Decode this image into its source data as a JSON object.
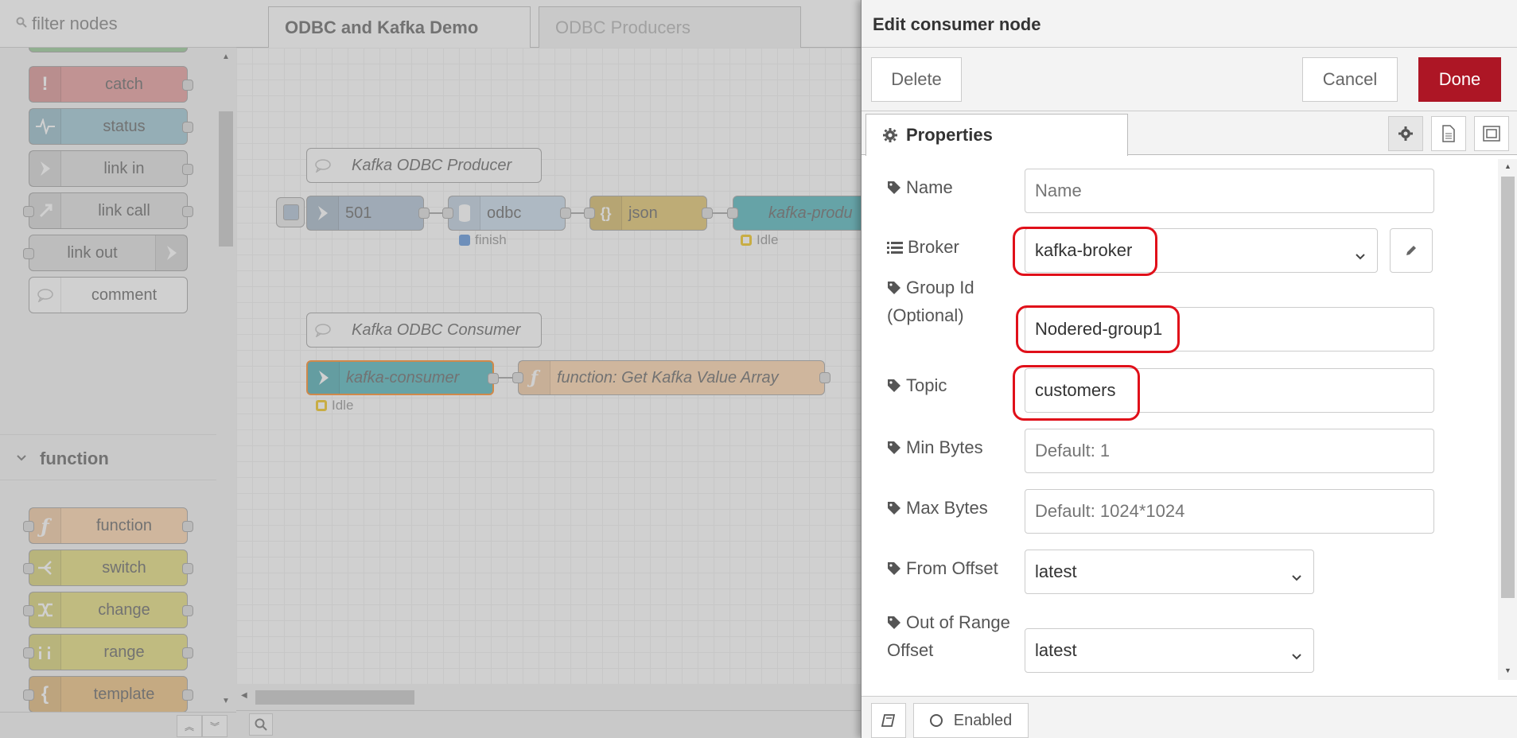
{
  "palette": {
    "search_placeholder": "filter nodes",
    "nodes_top": [
      {
        "label": "catch",
        "color": "#e49191"
      },
      {
        "label": "status",
        "color": "#94c1d0"
      },
      {
        "label": "link in",
        "color": "#dddddd"
      },
      {
        "label": "link call",
        "color": "#dddddd"
      },
      {
        "label": "link out",
        "color": "#dddddd"
      },
      {
        "label": "comment",
        "color": "#ffffff"
      }
    ],
    "category": "function",
    "nodes_function": [
      {
        "label": "function",
        "color": "#fdd0a2"
      },
      {
        "label": "switch",
        "color": "#e2d96e"
      },
      {
        "label": "change",
        "color": "#e2d96e"
      },
      {
        "label": "range",
        "color": "#e2d96e"
      },
      {
        "label": "template",
        "color": "#ebba71"
      }
    ]
  },
  "workspace": {
    "tabs": [
      "ODBC and Kafka Demo",
      "ODBC Producers"
    ],
    "flow": {
      "producer_comment": "Kafka ODBC Producer",
      "inject_label": "501",
      "odbc_label": "odbc",
      "odbc_status": "finish",
      "json_label": "json",
      "producer_label": "kafka-produ",
      "producer_status": "Idle",
      "consumer_comment": "Kafka ODBC Consumer",
      "consumer_label": "kafka-consumer",
      "consumer_status": "Idle",
      "function_label": "function: Get Kafka Value Array"
    }
  },
  "tray": {
    "title": "Edit consumer node",
    "delete_label": "Delete",
    "cancel_label": "Cancel",
    "done_label": "Done",
    "properties_tab": "Properties",
    "enabled_label": "Enabled",
    "accent": "#ad1625",
    "highlight": "#e0101a",
    "fields": {
      "name_label": "Name",
      "name_placeholder": "Name",
      "broker_label": "Broker",
      "broker_value": "kafka-broker",
      "groupid_label": "Group Id",
      "groupid_label2": "(Optional)",
      "groupid_value": "Nodered-group1",
      "topic_label": "Topic",
      "topic_value": "customers",
      "minbytes_label": "Min Bytes",
      "minbytes_placeholder": "Default: 1",
      "maxbytes_label": "Max Bytes",
      "maxbytes_placeholder": "Default: 1024*1024",
      "fromoffset_label": "From Offset",
      "fromoffset_value": "latest",
      "outofrange_label": "Out of Range",
      "outofrange_label2": "Offset",
      "outofrange_value": "latest"
    }
  }
}
